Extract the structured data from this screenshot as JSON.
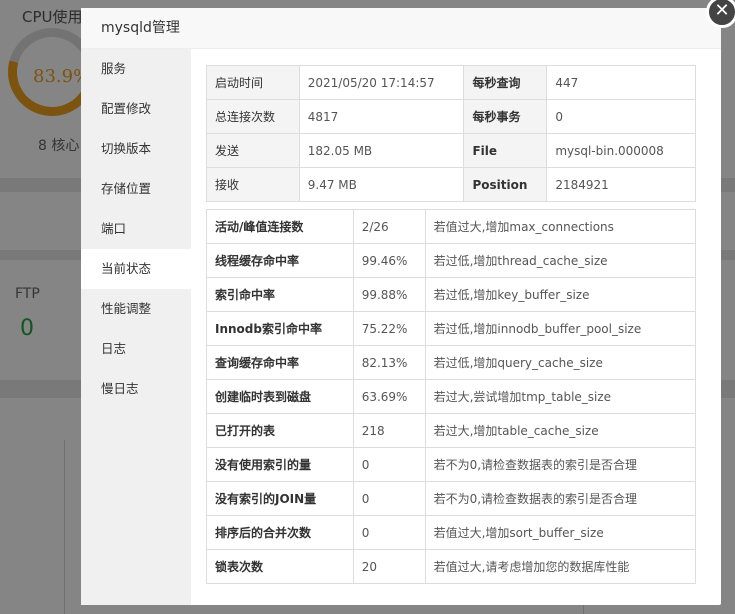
{
  "background": {
    "cpu_label": "CPU使用",
    "cpu_value": "83.9%",
    "cpu_fraction": 0.839,
    "cores": "8 核心",
    "ftp_label": "FTP",
    "ftp_count": "0"
  },
  "modal": {
    "title": "mysqld管理",
    "close_label": "✕",
    "nav_items": [
      {
        "label": "服务"
      },
      {
        "label": "配置修改"
      },
      {
        "label": "切换版本"
      },
      {
        "label": "存储位置"
      },
      {
        "label": "端口"
      },
      {
        "label": "当前状态",
        "active": true
      },
      {
        "label": "性能调整"
      },
      {
        "label": "日志"
      },
      {
        "label": "慢日志"
      }
    ],
    "info_rows": [
      {
        "label1": "启动时间",
        "value1": "2021/05/20 17:14:57",
        "label2": "每秒查询",
        "value2": "447"
      },
      {
        "label1": "总连接次数",
        "value1": "4817",
        "label2": "每秒事务",
        "value2": "0"
      },
      {
        "label1": "发送",
        "value1": "182.05 MB",
        "label2": "File",
        "value2": "mysql-bin.000008"
      },
      {
        "label1": "接收",
        "value1": "9.47 MB",
        "label2": "Position",
        "value2": "2184921"
      }
    ],
    "stats_rows": [
      {
        "label": "活动/峰值连接数",
        "value": "2/26",
        "tip": "若值过大,增加max_connections"
      },
      {
        "label": "线程缓存命中率",
        "value": "99.46%",
        "tip": "若过低,增加thread_cache_size"
      },
      {
        "label": "索引命中率",
        "value": "99.88%",
        "tip": "若过低,增加key_buffer_size"
      },
      {
        "label": "Innodb索引命中率",
        "value": "75.22%",
        "tip": "若过低,增加innodb_buffer_pool_size"
      },
      {
        "label": "查询缓存命中率",
        "value": "82.13%",
        "tip": "若过低,增加query_cache_size"
      },
      {
        "label": "创建临时表到磁盘",
        "value": "63.69%",
        "tip": "若过大,尝试增加tmp_table_size"
      },
      {
        "label": "已打开的表",
        "value": "218",
        "tip": "若过大,增加table_cache_size"
      },
      {
        "label": "没有使用索引的量",
        "value": "0",
        "tip": "若不为0,请检查数据表的索引是否合理"
      },
      {
        "label": "没有索引的JOIN量",
        "value": "0",
        "tip": "若不为0,请检查数据表的索引是否合理"
      },
      {
        "label": "排序后的合并次数",
        "value": "0",
        "tip": "若值过大,增加sort_buffer_size"
      },
      {
        "label": "锁表次数",
        "value": "20",
        "tip": "若值过大,请考虑增加您的数据库性能"
      }
    ]
  }
}
